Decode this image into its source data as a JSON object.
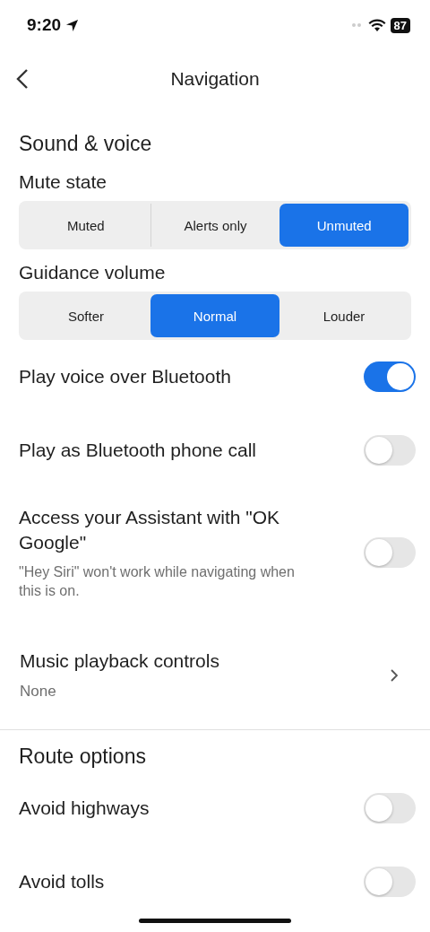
{
  "status_bar": {
    "time": "9:20",
    "battery": "87"
  },
  "header": {
    "title": "Navigation"
  },
  "sections": [
    {
      "title": "Sound & voice",
      "items": [
        {
          "kind": "segmented",
          "label": "Mute state",
          "options": [
            {
              "label": "Muted",
              "selected": false
            },
            {
              "label": "Alerts only",
              "selected": false
            },
            {
              "label": "Unmuted",
              "selected": true
            }
          ]
        },
        {
          "kind": "segmented",
          "label": "Guidance volume",
          "options": [
            {
              "label": "Softer",
              "selected": false
            },
            {
              "label": "Normal",
              "selected": true
            },
            {
              "label": "Louder",
              "selected": false
            }
          ]
        },
        {
          "kind": "toggle",
          "label": "Play voice over Bluetooth",
          "on": true
        },
        {
          "kind": "toggle",
          "label": "Play as Bluetooth phone call",
          "on": false
        },
        {
          "kind": "toggle",
          "label": "Access your Assistant with \"OK Google\"",
          "description": "\"Hey Siri\" won't work while navigating when this is on.",
          "on": false
        },
        {
          "kind": "link",
          "label": "Music playback controls",
          "value": "None"
        }
      ]
    },
    {
      "title": "Route options",
      "items": [
        {
          "kind": "toggle",
          "label": "Avoid highways",
          "on": false
        },
        {
          "kind": "toggle",
          "label": "Avoid tolls",
          "on": false
        }
      ]
    }
  ]
}
